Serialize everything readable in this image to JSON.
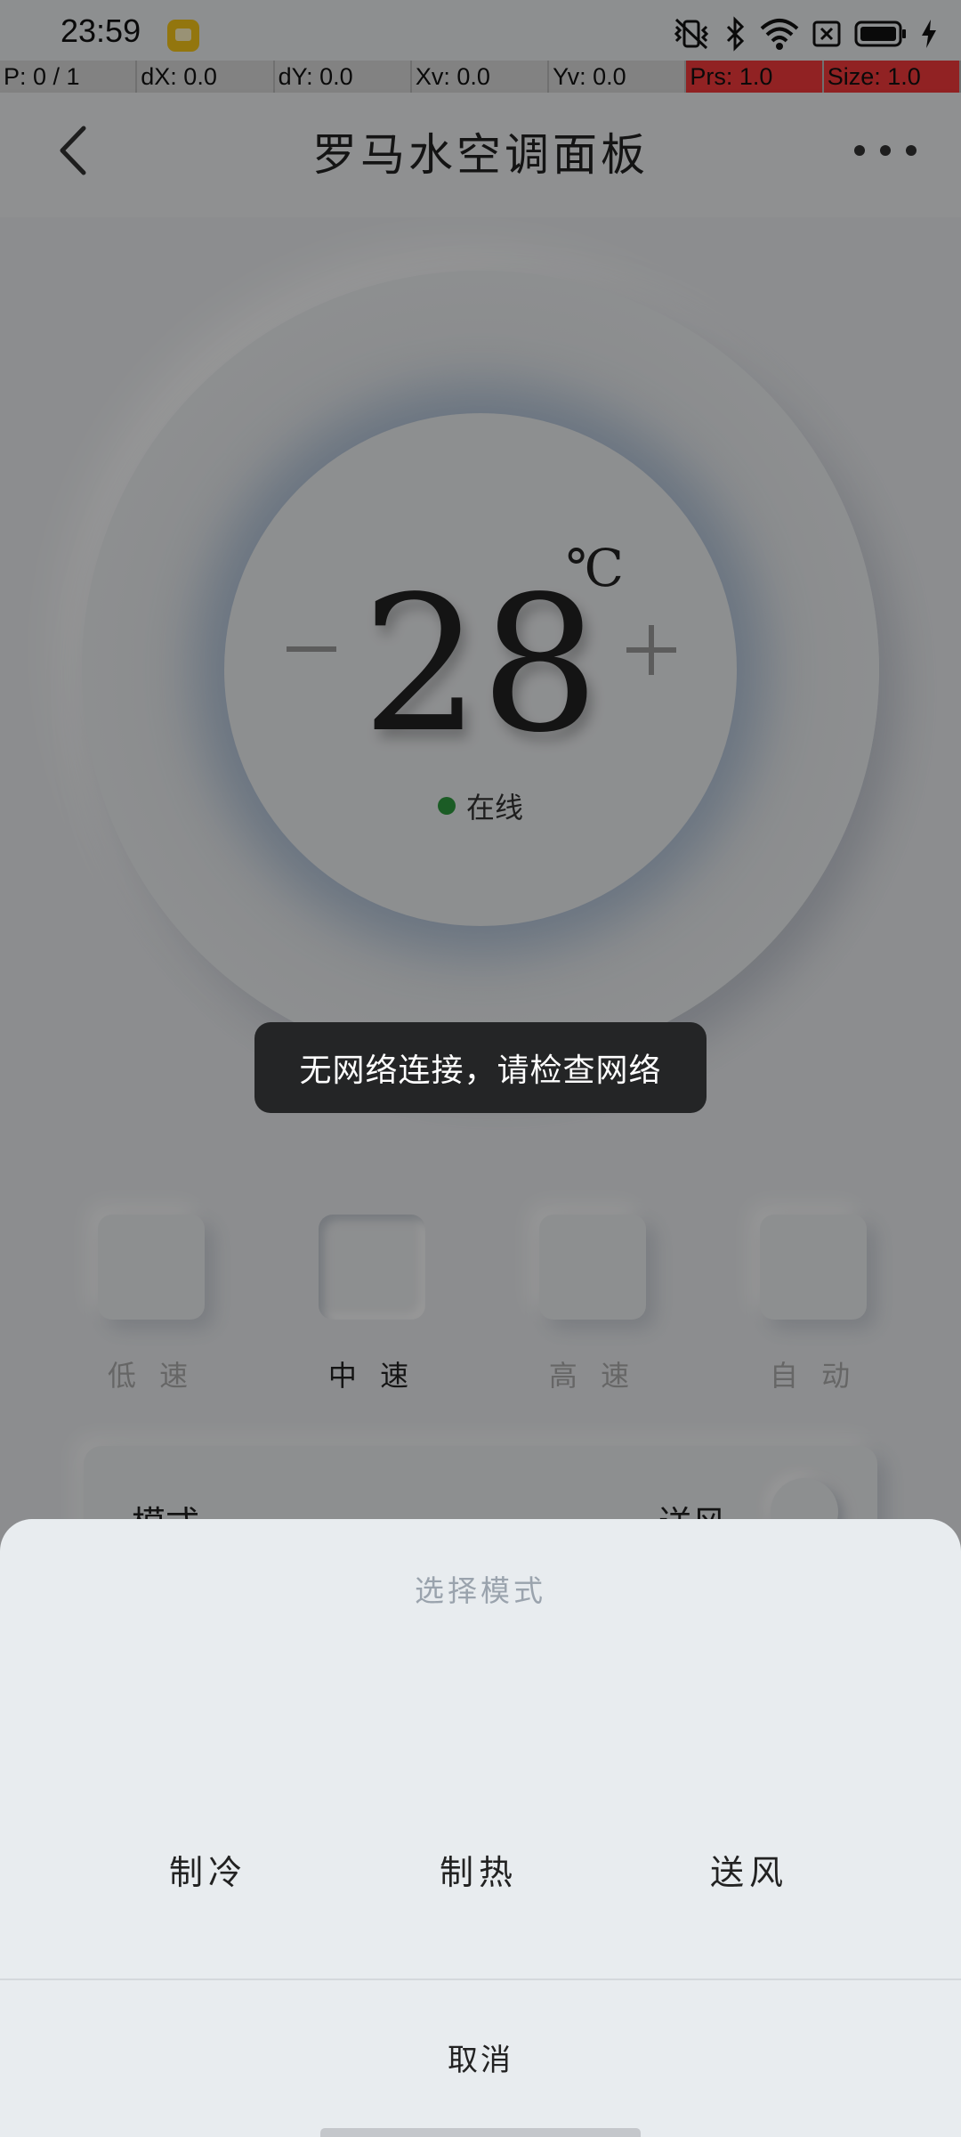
{
  "status_bar": {
    "time": "23:59",
    "icons": [
      "notification-app-icon",
      "mute-vibrate-icon",
      "bluetooth-icon",
      "wifi-icon",
      "sim-none-icon",
      "battery-icon",
      "charging-icon"
    ]
  },
  "debug_bar": {
    "pointer": "P: 0 / 1",
    "dx": "dX: 0.0",
    "dy": "dY: 0.0",
    "xv": "Xv: 0.0",
    "yv": "Yv: 0.0",
    "prs": "Prs: 1.0",
    "size": "Size: 1.0"
  },
  "header": {
    "title": "罗马水空调面板",
    "back_icon": "chevron-left-icon",
    "more_icon": "more-horizontal-icon"
  },
  "thermostat": {
    "temperature": "28",
    "unit": "℃",
    "status": "在线",
    "status_color": "#2e9a3e"
  },
  "fan_speeds": [
    {
      "label": "低 速",
      "active": false
    },
    {
      "label": "中 速",
      "active": true
    },
    {
      "label": "高 速",
      "active": false
    },
    {
      "label": "自 动",
      "active": false
    }
  ],
  "mode_row": {
    "key": "模式",
    "value": "送风"
  },
  "toast": {
    "message": "无网络连接，请检查网络"
  },
  "mode_sheet": {
    "title": "选择模式",
    "options": [
      "制冷",
      "制热",
      "送风"
    ],
    "cancel_label": "取消"
  }
}
